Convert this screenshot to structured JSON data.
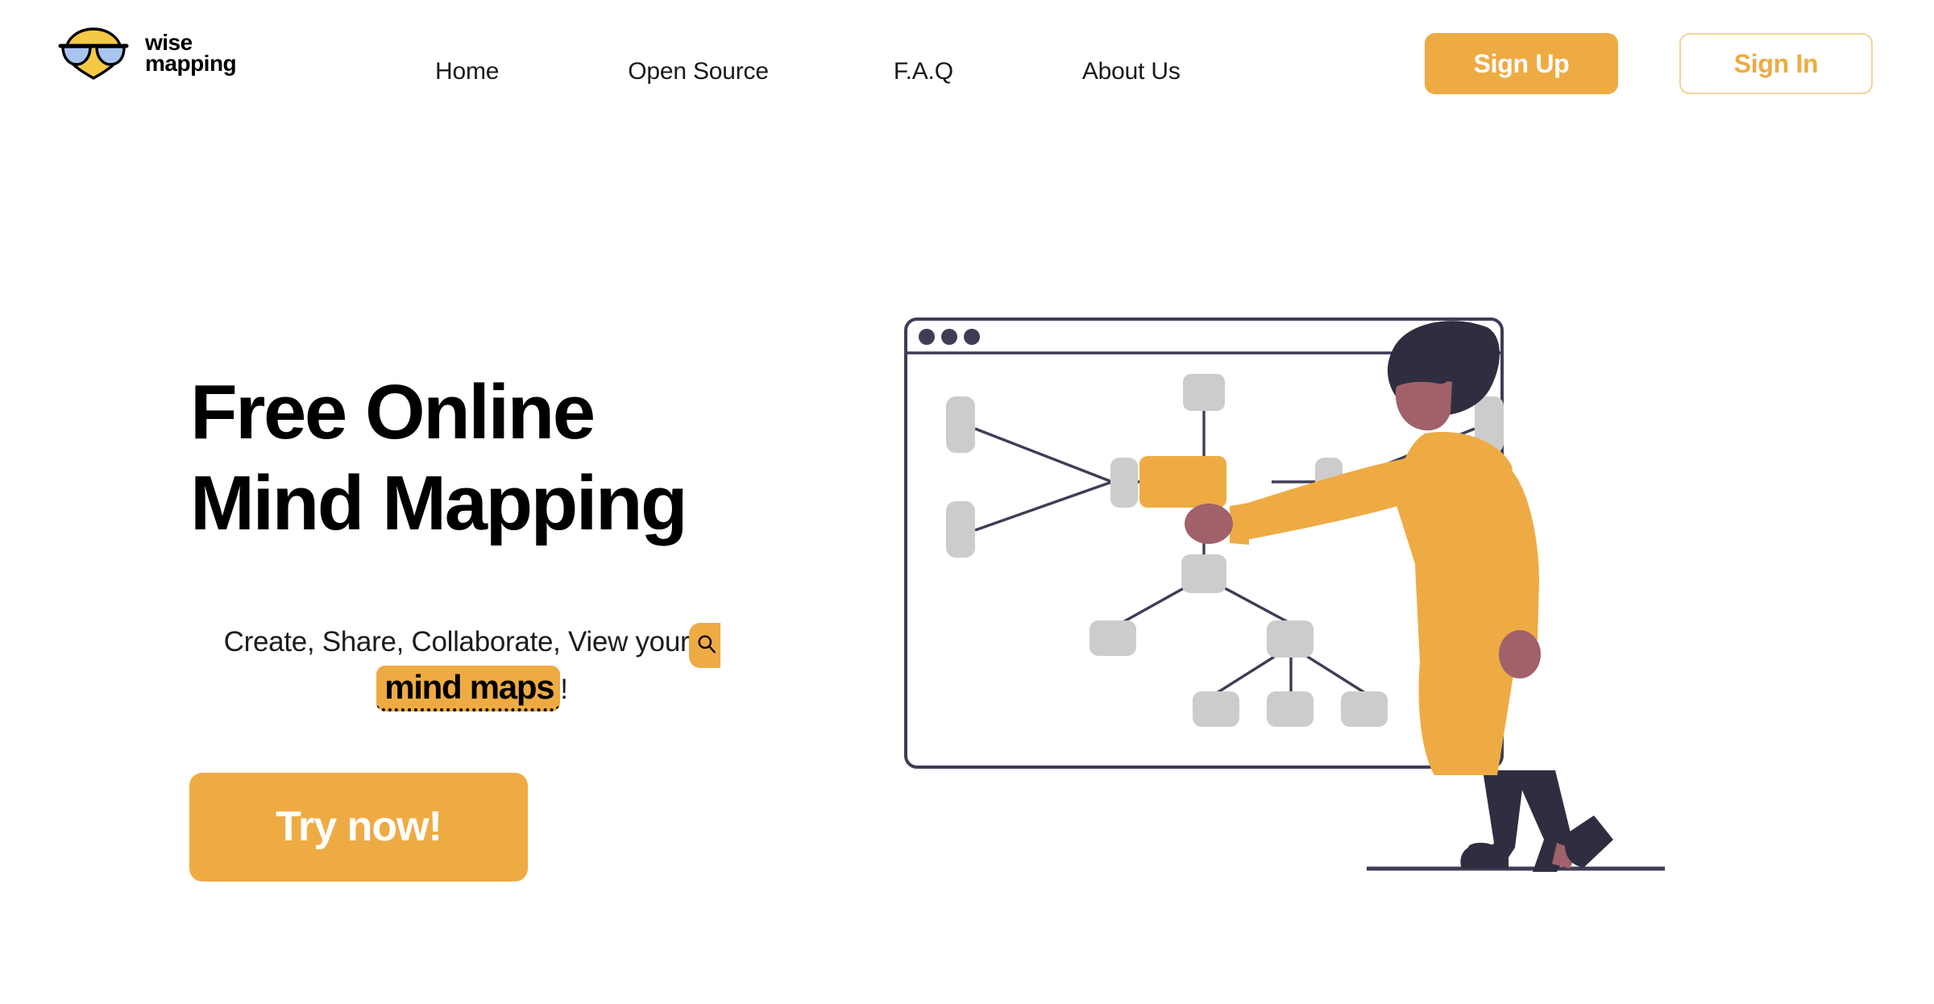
{
  "brand": {
    "name_line1": "wise",
    "name_line2": "mapping",
    "logo_icon": "wisemapping-sunglasses-logo",
    "colors": {
      "accent": "#eeab44",
      "logo_yellow": "#f5c944",
      "logo_blue": "#a8c5ef",
      "ink": "#3f3d56",
      "node_gray": "#cccccc"
    }
  },
  "header": {
    "nav": [
      {
        "label": "Home",
        "name": "nav-home"
      },
      {
        "label": "Open Source",
        "name": "nav-open-source"
      },
      {
        "label": "F.A.Q",
        "name": "nav-faq"
      },
      {
        "label": "About Us",
        "name": "nav-about-us"
      }
    ],
    "sign_up_label": "Sign Up",
    "sign_in_label": "Sign In"
  },
  "hero": {
    "title": "Free Online\nMind Mapping",
    "subtitle_prefix": "Create, Share, Collaborate, View your",
    "search_icon": "search-icon",
    "highlight_text": "mind maps",
    "subtitle_suffix": "!",
    "cta_label": "Try now!"
  },
  "illustration": {
    "name": "mind-map-browser-and-person",
    "browser_dots": 3,
    "mindmap": {
      "root": {
        "id": "root",
        "color": "#eeab44"
      },
      "nodes": [
        {
          "id": "top",
          "color": "#cccccc"
        },
        {
          "id": "left-hub",
          "color": "#cccccc"
        },
        {
          "id": "left-upper",
          "color": "#cccccc"
        },
        {
          "id": "left-lower",
          "color": "#cccccc"
        },
        {
          "id": "right-hub",
          "color": "#cccccc"
        },
        {
          "id": "right-upper",
          "color": "#cccccc"
        },
        {
          "id": "right-lower",
          "color": "#cccccc"
        },
        {
          "id": "bottom-hub",
          "color": "#cccccc"
        },
        {
          "id": "bottom-left",
          "color": "#cccccc"
        },
        {
          "id": "bottom-right",
          "color": "#cccccc"
        },
        {
          "id": "leaf-1",
          "color": "#cccccc"
        },
        {
          "id": "leaf-2",
          "color": "#cccccc"
        },
        {
          "id": "leaf-3",
          "color": "#cccccc"
        }
      ]
    },
    "person": {
      "name": "person-pointing-at-screen",
      "sweater_color": "#eeab44",
      "pants_color": "#2f2e41",
      "hair_color": "#2f2e41",
      "skin_color": "#a0616a"
    }
  }
}
